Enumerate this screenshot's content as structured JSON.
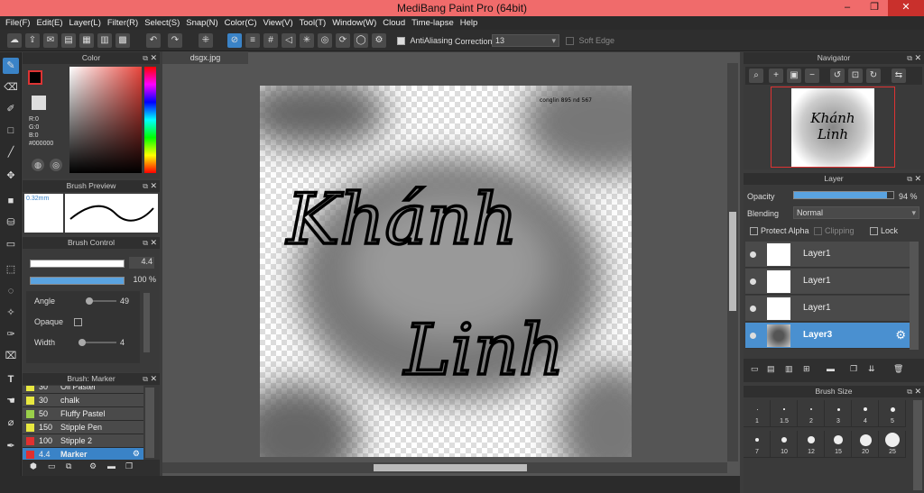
{
  "window": {
    "title": "MediBang Paint Pro (64bit)",
    "min": "–",
    "max": "❐",
    "close": "✕"
  },
  "menu": [
    "File(F)",
    "Edit(E)",
    "Layer(L)",
    "Filter(R)",
    "Select(S)",
    "Snap(N)",
    "Color(C)",
    "View(V)",
    "Tool(T)",
    "Window(W)",
    "Cloud",
    "Time-lapse",
    "Help"
  ],
  "toolbar": {
    "antialiasing": "AntiAliasing",
    "correction_label": "Correction",
    "correction_value": "13",
    "soft_edge": "Soft Edge"
  },
  "color_panel": {
    "title": "Color",
    "r": "R:0",
    "g": "G:0",
    "b": "B:0",
    "hex": "#000000"
  },
  "brush_preview": {
    "title": "Brush Preview",
    "size": "0.32mm"
  },
  "brush_control": {
    "title": "Brush Control",
    "size": "4.4",
    "opacity": "100 %",
    "angle_label": "Angle",
    "angle": "49",
    "opaque_label": "Opaque",
    "width_label": "Width",
    "width": "4"
  },
  "brush_list": {
    "title": "Brush: Marker",
    "items": [
      {
        "size": "30",
        "name": "Oil Pastel",
        "color": "#e8e840"
      },
      {
        "size": "30",
        "name": "chalk",
        "color": "#e8e840"
      },
      {
        "size": "50",
        "name": "Fluffy Pastel",
        "color": "#9ad04a"
      },
      {
        "size": "150",
        "name": "Stipple Pen",
        "color": "#e8e840"
      },
      {
        "size": "100",
        "name": "Stipple 2",
        "color": "#e03030"
      },
      {
        "size": "4.4",
        "name": "Marker",
        "color": "#e03030"
      }
    ]
  },
  "document": {
    "tab": "dsgx.jpg",
    "line1": "Khánh",
    "line2": "Linh",
    "signature": "conglin 895 nd 567"
  },
  "navigator": {
    "title": "Navigator",
    "thumb_text": "Khánh Linh"
  },
  "layer_panel": {
    "title": "Layer",
    "opacity_label": "Opacity",
    "opacity": "94 %",
    "opacity_fraction": 0.94,
    "blending_label": "Blending",
    "blending": "Normal",
    "protect_alpha": "Protect Alpha",
    "clipping": "Clipping",
    "lock": "Lock",
    "layers": [
      {
        "name": "Layer1",
        "selected": false
      },
      {
        "name": "Layer1",
        "selected": false
      },
      {
        "name": "Layer1",
        "selected": false
      },
      {
        "name": "Layer3",
        "selected": true
      }
    ]
  },
  "brush_size": {
    "title": "Brush Size",
    "row1": [
      "1",
      "1.5",
      "2",
      "3",
      "4",
      "5"
    ],
    "row2": [
      "7",
      "10",
      "12",
      "15",
      "20",
      "25"
    ]
  },
  "colors": {
    "accent": "#3a83c7",
    "titlebar": "#f06b6b",
    "close": "#c9302c"
  }
}
